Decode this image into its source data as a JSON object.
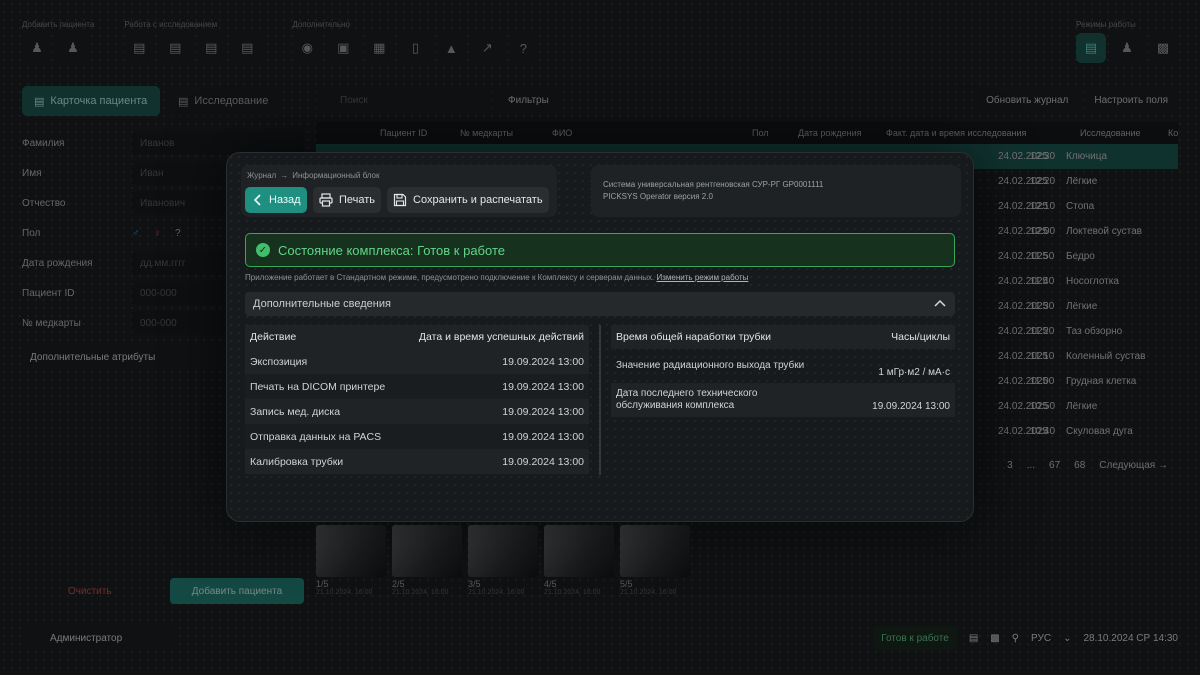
{
  "toolbar": {
    "group_add": "Добавить пациента",
    "group_work": "Работа с исследованием",
    "group_extra": "Дополнительно",
    "group_modes": "Режимы работы"
  },
  "left_panel": {
    "tab_card": "Карточка пациента",
    "tab_study": "Исследование",
    "fields": [
      {
        "label": "Фамилия",
        "placeholder": "Иванов"
      },
      {
        "label": "Имя",
        "placeholder": "Иван"
      },
      {
        "label": "Отчество",
        "placeholder": "Иванович"
      },
      {
        "label": "Пол",
        "placeholder": "?"
      },
      {
        "label": "Дата рождения",
        "placeholder": "дд.мм.гггг"
      },
      {
        "label": "Пациент ID",
        "placeholder": "000-000"
      },
      {
        "label": "№ медкарты",
        "placeholder": "000-000"
      }
    ],
    "extra_attrs": "Дополнительные атрибуты",
    "clear": "Очистить",
    "add": "Добавить пациента"
  },
  "right_panel": {
    "search_placeholder": "Поиск",
    "filters": "Фильтры",
    "refresh": "Обновить журнал",
    "configure": "Настроить поля",
    "columns": [
      "Пациент ID",
      "№ медкарты",
      "ФИО",
      "Пол",
      "Дата рождения",
      "Факт. дата и время исследования",
      "Исследование",
      "Ко"
    ],
    "rows": [
      {
        "date": "24.02.2025",
        "time": "12:30",
        "study": "Ключица"
      },
      {
        "date": "24.02.2025",
        "time": "12:20",
        "study": "Лёгкие"
      },
      {
        "date": "24.02.2025",
        "time": "12:10",
        "study": "Стопа"
      },
      {
        "date": "24.02.2025",
        "time": "12:00",
        "study": "Локтевой сустав"
      },
      {
        "date": "24.02.2025",
        "time": "11:50",
        "study": "Бедро"
      },
      {
        "date": "24.02.2025",
        "time": "11:40",
        "study": "Носоглотка"
      },
      {
        "date": "24.02.2025",
        "time": "11:30",
        "study": "Лёгкие"
      },
      {
        "date": "24.02.2025",
        "time": "11:20",
        "study": "Таз обзорно"
      },
      {
        "date": "24.02.2025",
        "time": "11:10",
        "study": "Коленный сустав"
      },
      {
        "date": "24.02.2025",
        "time": "11:00",
        "study": "Грудная клетка"
      },
      {
        "date": "24.02.2025",
        "time": "10:50",
        "study": "Лёгкие"
      },
      {
        "date": "24.02.2025",
        "time": "10:40",
        "study": "Скуловая дуга"
      }
    ],
    "pager": {
      "p1": "3",
      "dots": "...",
      "p2": "67",
      "p3": "68",
      "next": "Следующая →"
    }
  },
  "thumbs": [
    {
      "label": "1/5",
      "date": "21.10.2024, 16:00"
    },
    {
      "label": "2/5",
      "date": "21.10.2024, 16:00"
    },
    {
      "label": "3/5",
      "date": "21.10.2024, 16:00"
    },
    {
      "label": "4/5",
      "date": "21.10.2024, 16:00"
    },
    {
      "label": "5/5",
      "date": "21.10.2024, 16:00"
    }
  ],
  "statusbar": {
    "user": "Администратор",
    "ready": "Готов к работе",
    "lang": "РУС",
    "datetime": "28.10.2024  СР  14:30"
  },
  "modal": {
    "crumb_from": "Журнал",
    "crumb_arrow": "→",
    "crumb_to": "Информационный блок",
    "back": "Назад",
    "print": "Печать",
    "save_print": "Сохранить и распечатать",
    "system_line1": "Система универсальная рентгеновская СУР-РГ GP0001111",
    "system_line2": "PICKSYS Operator версия 2.0",
    "status": "Состояние комплекса: Готов к работе",
    "note": "Приложение работает в Стандартном режиме, предусмотрено подключение к Комплексу и серверам данных.",
    "note_link": "Изменить режим работы",
    "section": "Дополнительные сведения",
    "left_table": {
      "h1": "Действие",
      "h2": "Дата и время успешных действий",
      "rows": [
        {
          "action": "Экспозиция",
          "dt": "19.09.2024 13:00"
        },
        {
          "action": "Печать на DICOM принтере",
          "dt": "19.09.2024 13:00"
        },
        {
          "action": "Запись мед. диска",
          "dt": "19.09.2024 13:00"
        },
        {
          "action": "Отправка данных на PACS",
          "dt": "19.09.2024 13:00"
        },
        {
          "action": "Калибровка трубки",
          "dt": "19.09.2024 13:00"
        }
      ]
    },
    "right_table": {
      "h1": "Время общей наработки трубки",
      "h2": "Часы/циклы",
      "rows": [
        {
          "label": "Значение радиационного выхода трубки",
          "value": "1 мГр·м2 / мА·с"
        },
        {
          "label": "Дата последнего технического обслуживания комплекса",
          "value": "19.09.2024 13:00"
        }
      ]
    }
  }
}
